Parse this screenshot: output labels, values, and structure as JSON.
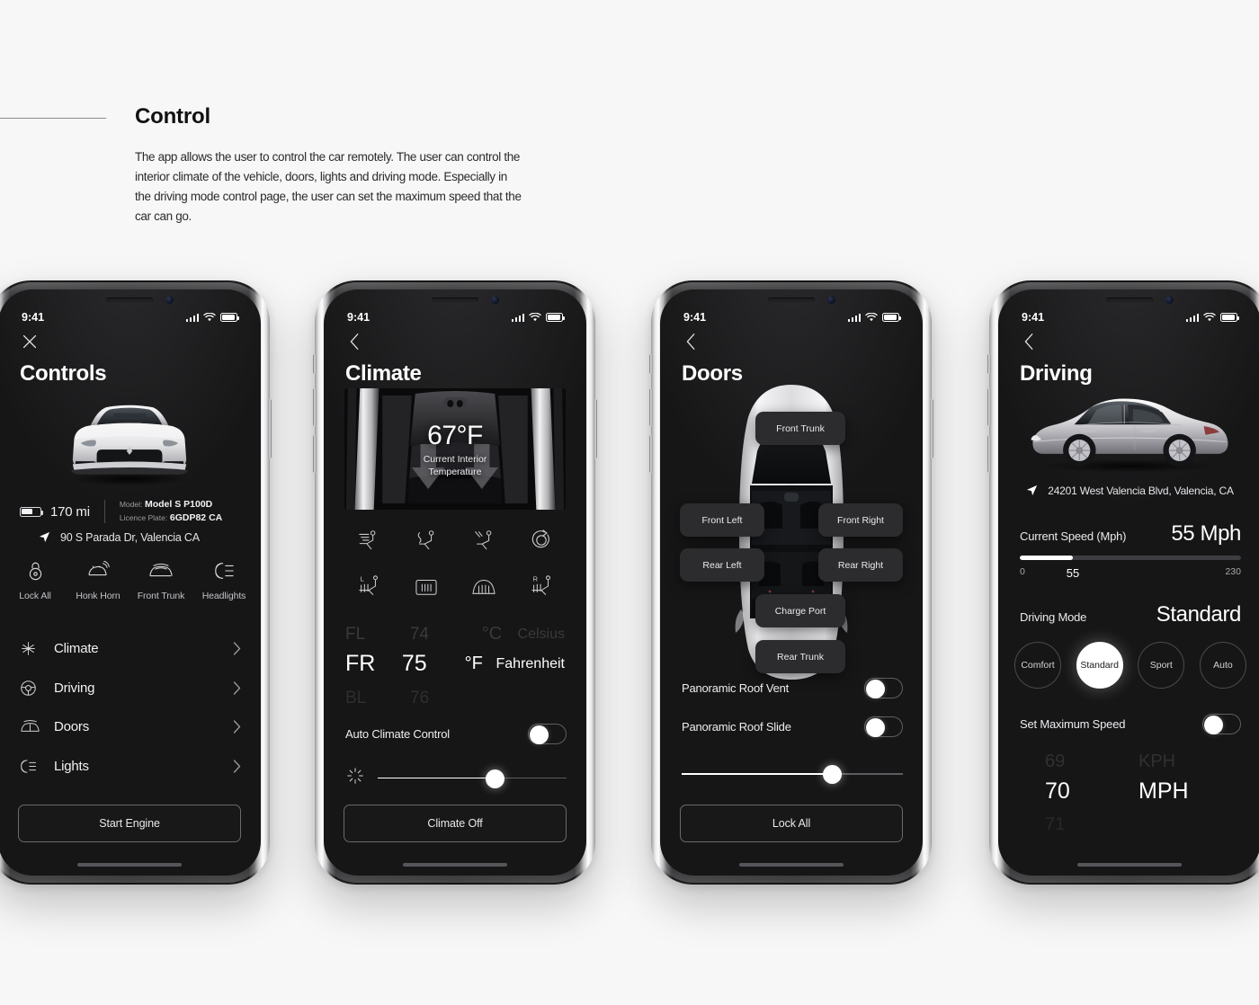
{
  "header": {
    "title": "Control",
    "body": "The app allows the user to control the car remotely. The user can control the interior climate of the vehicle, doors, lights and driving mode. Especially in the driving mode control page, the user can set the maximum speed that the car can go."
  },
  "status_bar": {
    "time": "9:41"
  },
  "screen_controls": {
    "title": "Controls",
    "close_icon": "close-icon",
    "range": "170 mi",
    "model_key": "Model:",
    "model_value": "Model S P100D",
    "plate_key": "Licence Plate:",
    "plate_value": "6GDP82 CA",
    "address": "90 S Parada Dr, Valencia CA",
    "quick_actions": [
      {
        "label": "Lock All",
        "icon": "lock-icon"
      },
      {
        "label": "Honk Horn",
        "icon": "horn-icon"
      },
      {
        "label": "Front Trunk",
        "icon": "frunk-icon"
      },
      {
        "label": "Headlights",
        "icon": "headlight-icon"
      }
    ],
    "list_items": [
      {
        "label": "Climate",
        "icon": "fan-icon"
      },
      {
        "label": "Driving",
        "icon": "steering-wheel-icon"
      },
      {
        "label": "Doors",
        "icon": "car-doors-icon"
      },
      {
        "label": "Lights",
        "icon": "headlight-icon"
      }
    ],
    "primary_button": "Start Engine"
  },
  "screen_climate": {
    "title": "Climate",
    "back_icon": "chevron-left-icon",
    "interior_temp": "67°F",
    "interior_temp_label_l1": "Current Interior",
    "interior_temp_label_l2": "Temperature",
    "vent_icons": [
      "vent-face-icon",
      "vent-seat-back-icon",
      "vent-feet-icon",
      "recirculate-icon",
      "seat-heater-left-icon",
      "rear-defrost-icon",
      "front-defrost-icon",
      "seat-heater-right-icon"
    ],
    "picker": {
      "zone_prev": "FL",
      "zone_sel": "FR",
      "zone_next": "BL",
      "temp_prev": "74",
      "temp_sel": "75",
      "temp_next": "76",
      "unit_prev_sym": "°C",
      "unit_prev_name": "Celsius",
      "unit_sel_sym": "°F",
      "unit_sel_name": "Fahrenheit"
    },
    "auto_label": "Auto Climate Control",
    "auto_on": true,
    "fan_slider_value": 62,
    "primary_button": "Climate Off"
  },
  "screen_doors": {
    "title": "Doors",
    "back_icon": "chevron-left-icon",
    "pills": [
      {
        "label": "Front Trunk"
      },
      {
        "label": "Front Left"
      },
      {
        "label": "Front Right"
      },
      {
        "label": "Rear Left"
      },
      {
        "label": "Rear Right"
      },
      {
        "label": "Charge Port"
      },
      {
        "label": "Rear Trunk"
      }
    ],
    "roof_vent_label": "Panoramic Roof Vent",
    "roof_vent_on": true,
    "roof_slide_label": "Panoramic Roof Slide",
    "roof_slide_on": true,
    "roof_slider_value": 68,
    "primary_button": "Lock All"
  },
  "screen_driving": {
    "title": "Driving",
    "back_icon": "chevron-left-icon",
    "address": "24201 West Valencia Blvd, Valencia, CA",
    "speed_label": "Current Speed (Mph)",
    "speed_value": "55 Mph",
    "speed_min": "0",
    "speed_current": "55",
    "speed_max": "230",
    "speed_pct": 24,
    "mode_label": "Driving Mode",
    "mode_value": "Standard",
    "modes": [
      {
        "label": "Comfort",
        "selected": false
      },
      {
        "label": "Standard",
        "selected": true
      },
      {
        "label": "Sport",
        "selected": false
      },
      {
        "label": "Auto",
        "selected": false
      }
    ],
    "max_speed_label": "Set Maximum Speed",
    "max_speed_on": true,
    "max_picker": {
      "num_prev": "69",
      "num_sel": "70",
      "num_next": "71",
      "unit_prev": "KPH",
      "unit_sel": "MPH"
    }
  },
  "colors": {
    "screen_bg": "#161617",
    "accent": "#ffffff",
    "page_bg": "#f7f7f7"
  }
}
